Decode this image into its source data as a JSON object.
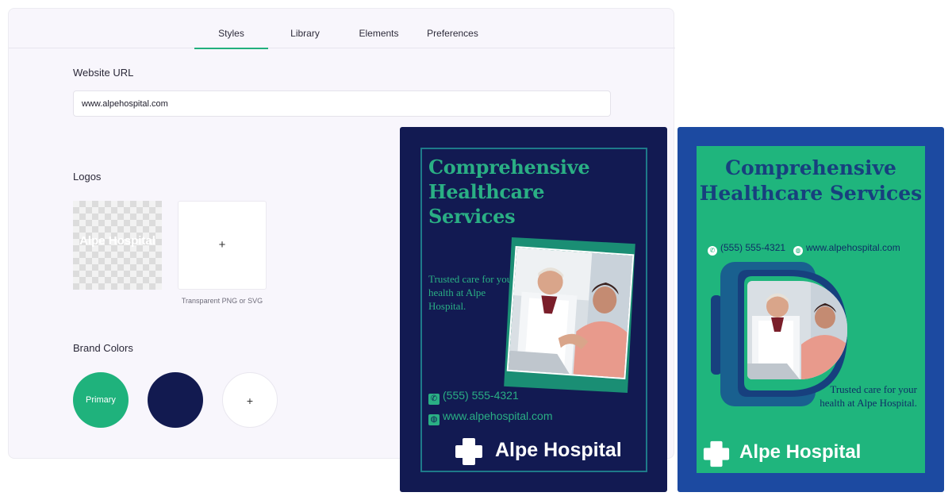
{
  "tabs": [
    {
      "label": "Styles",
      "active": true
    },
    {
      "label": "Library",
      "active": false
    },
    {
      "label": "Elements",
      "active": false
    },
    {
      "label": "Preferences",
      "active": false
    }
  ],
  "website": {
    "label": "Website URL",
    "value": "www.alpehospital.com"
  },
  "logos": {
    "label": "Logos",
    "preview_text": "Alpe Hospital",
    "add_glyph": "+",
    "hint": "Transparent PNG or SVG"
  },
  "brand_colors": {
    "label": "Brand Colors",
    "swatches": [
      {
        "label": "Primary",
        "color": "#1fb27c"
      },
      {
        "label": "",
        "color": "#121a50"
      },
      {
        "label": "+",
        "color": "#ffffff"
      }
    ]
  },
  "poster_dark": {
    "title": "Comprehensive Healthcare Services",
    "tagline": "Trusted care for your health at Alpe Hospital.",
    "phone": "(555) 555-4321",
    "website": "www.alpehospital.com",
    "brand": "Alpe Hospital",
    "colors": {
      "background": "#121a52",
      "accent": "#2aaf84",
      "frame": "#1e7a8a"
    },
    "icons": [
      "phone-icon",
      "globe-icon",
      "cross-logo-icon"
    ]
  },
  "poster_green": {
    "title": "Comprehensive Healthcare Services",
    "phone": "(555) 555-4321",
    "website": "www.alpehospital.com",
    "tagline": "Trusted care for your health at Alpe Hospital.",
    "brand": "Alpe Hospital",
    "colors": {
      "background": "#1c4aa1",
      "panel": "#1fb57d",
      "text": "#17407e"
    },
    "icons": [
      "phone-icon",
      "globe-icon",
      "cross-logo-icon"
    ]
  }
}
